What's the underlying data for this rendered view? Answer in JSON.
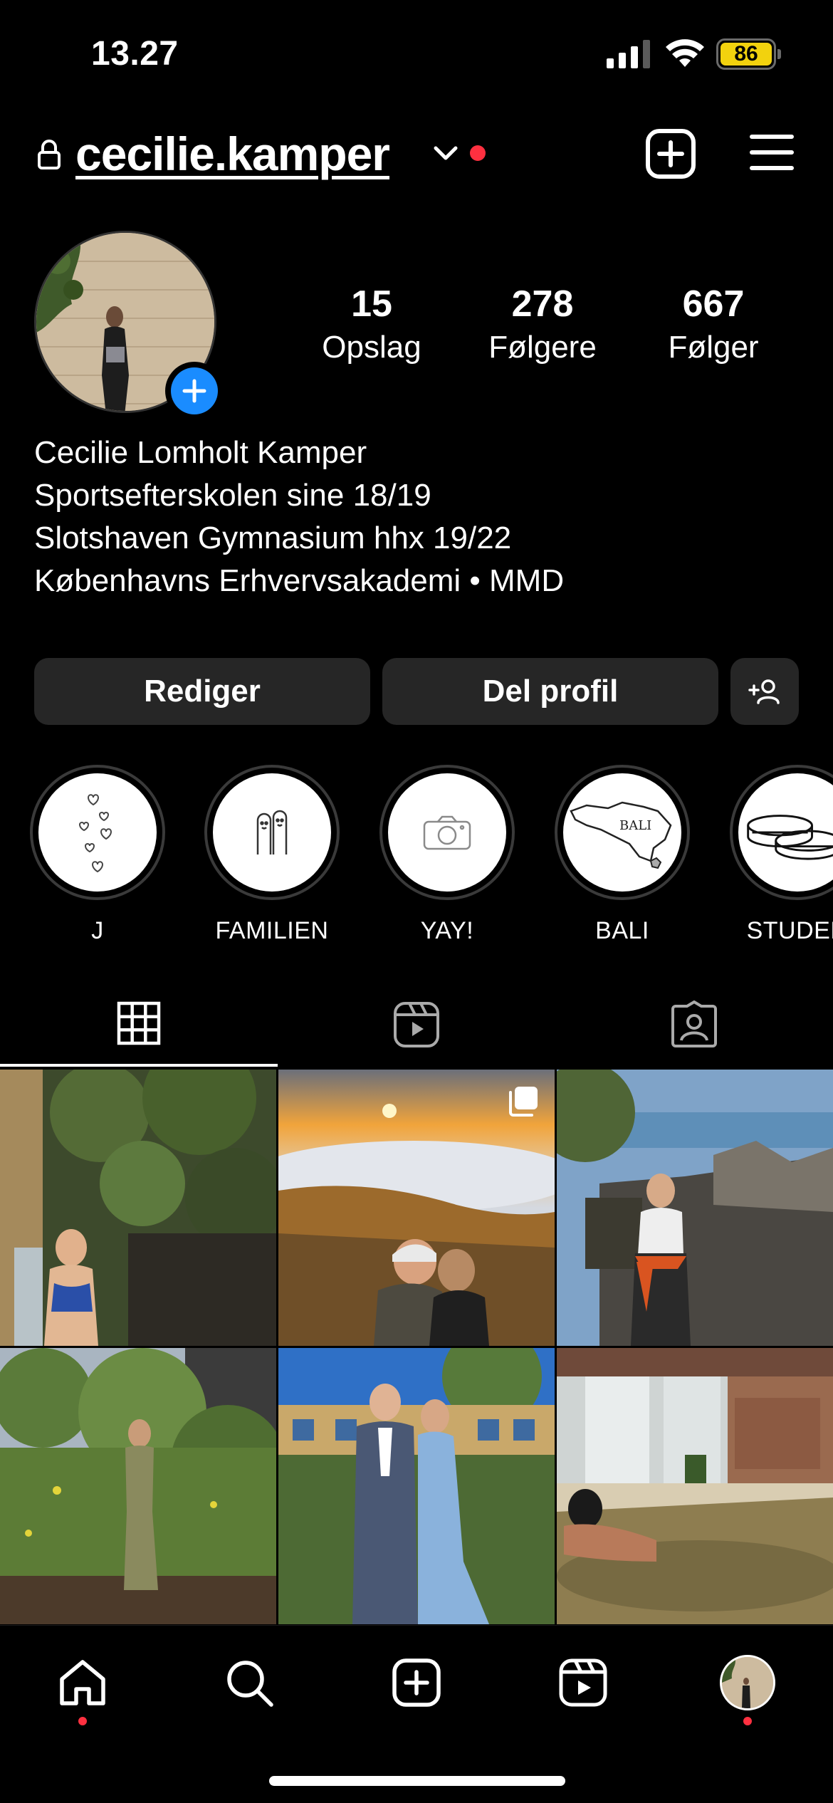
{
  "status_bar": {
    "time": "13.27",
    "battery": "86"
  },
  "header": {
    "username": "cecilie.kamper"
  },
  "profile": {
    "stats": [
      {
        "value": "15",
        "label": "Opslag"
      },
      {
        "value": "278",
        "label": "Følgere"
      },
      {
        "value": "667",
        "label": "Følger"
      }
    ],
    "bio": [
      "Cecilie Lomholt Kamper",
      "Sportsefterskolen sine 18/19",
      "Slotshaven Gymnasium hhx 19/22",
      "Københavns Erhvervsakademi • MMD"
    ]
  },
  "actions": {
    "edit": "Rediger",
    "share": "Del profil"
  },
  "highlights": [
    {
      "label": "J"
    },
    {
      "label": "FAMILIEN"
    },
    {
      "label": "YAY!"
    },
    {
      "label": "BALI",
      "map_text": "BALI"
    },
    {
      "label": "STUDEN"
    }
  ],
  "tabs": [
    "grid-icon",
    "reels-icon",
    "tagged-icon"
  ],
  "bottom_nav": [
    "home-icon",
    "search-icon",
    "create-icon",
    "reels-icon",
    "profile-avatar"
  ],
  "colors": {
    "accent_blue": "#1a8cff",
    "notification_red": "#ff3040",
    "button_bg": "#262626",
    "battery_yellow": "#f2d20e"
  }
}
